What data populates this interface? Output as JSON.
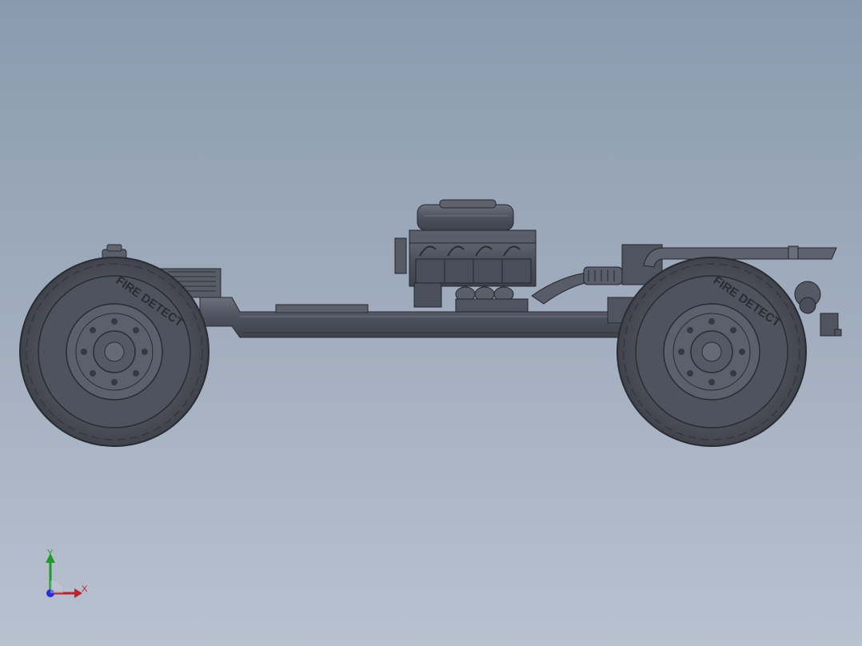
{
  "viewport": {
    "background_top": "#8a9aae",
    "background_bottom": "#b8c1cf",
    "model_color": "#4e525c"
  },
  "tire_text": "FIRE DETECT",
  "triad": {
    "y_label": "Y",
    "x_label": "X",
    "y_color": "#1f9a2a",
    "x_color": "#c0202a",
    "z_color": "#2a2ad8"
  }
}
